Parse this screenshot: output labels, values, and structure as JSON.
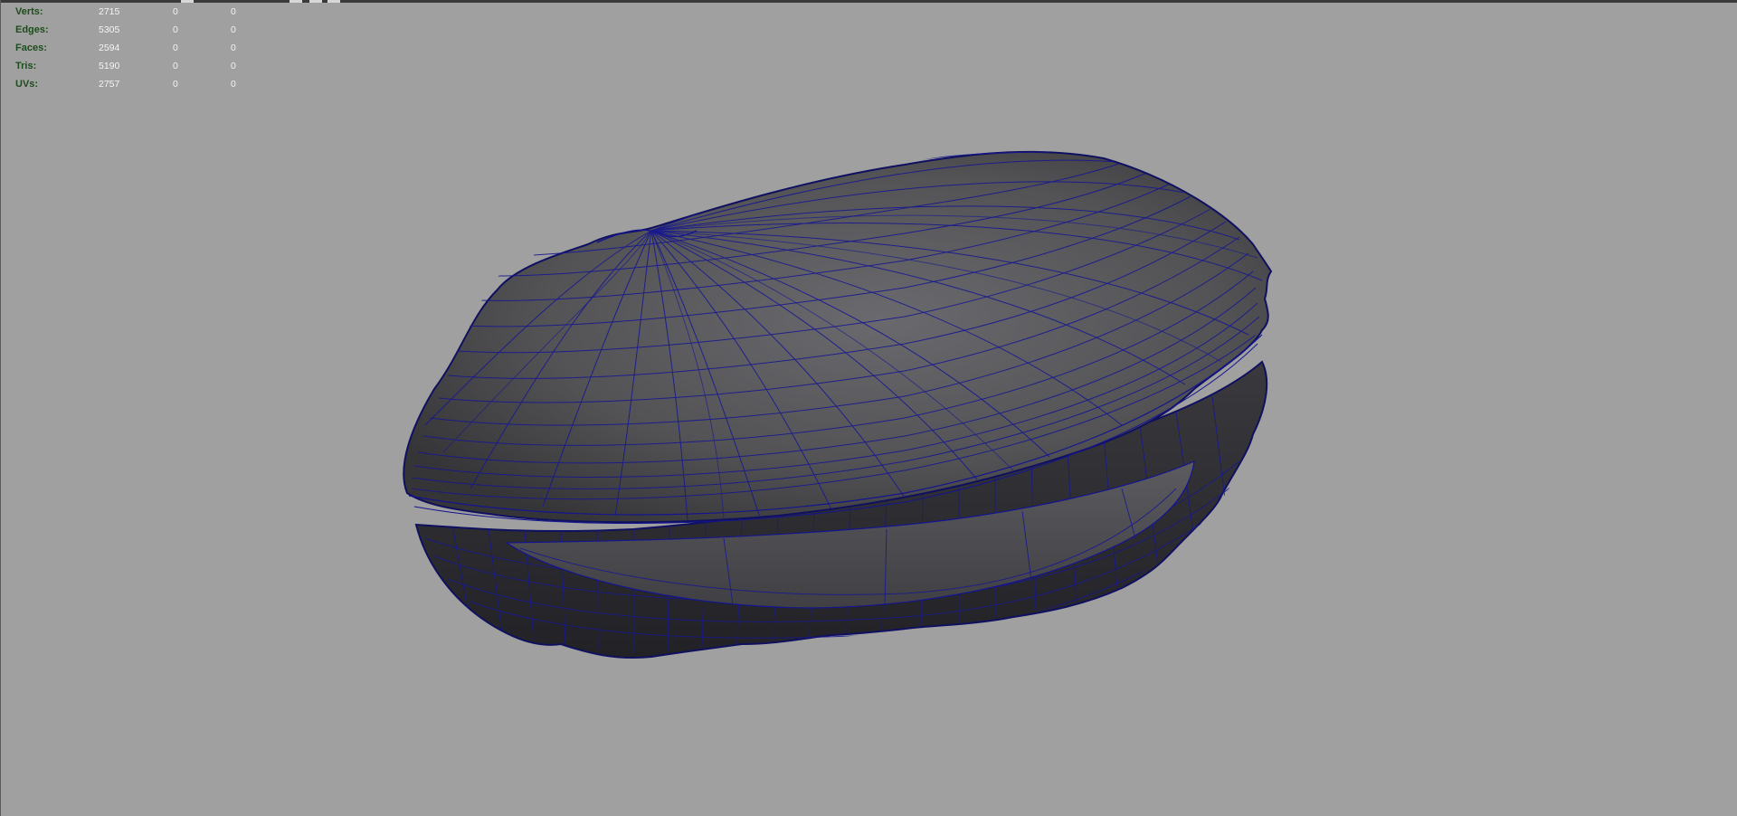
{
  "viewport": {
    "background_color": "#a0a0a0",
    "model_shading_color": "#555558",
    "wireframe_color": "#141490"
  },
  "hud": {
    "rows": [
      {
        "label": "Verts:",
        "total": "2715",
        "selected": "0",
        "selected_comp": "0"
      },
      {
        "label": "Edges:",
        "total": "5305",
        "selected": "0",
        "selected_comp": "0"
      },
      {
        "label": "Faces:",
        "total": "2594",
        "selected": "0",
        "selected_comp": "0"
      },
      {
        "label": "Tris:",
        "total": "5190",
        "selected": "0",
        "selected_comp": "0"
      },
      {
        "label": "UVs:",
        "total": "2757",
        "selected": "0",
        "selected_comp": "0"
      }
    ]
  }
}
